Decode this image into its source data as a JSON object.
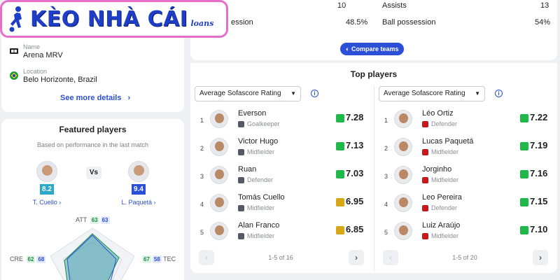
{
  "brand": {
    "title": "KÈO NHÀ CÁI",
    "subtitle": "loans"
  },
  "venue": {
    "name_label": "Name",
    "name_value": "Arena MRV",
    "location_label": "Location",
    "location_value": "Belo Horizonte, Brazil",
    "see_more": "See more details"
  },
  "featured": {
    "title": "Featured players",
    "subtitle": "Based on performance in the last match",
    "vs": "Vs",
    "left": {
      "name": "T. Cuello",
      "rating": "8.2",
      "color": "#2aa8c9"
    },
    "right": {
      "name": "L. Paquetá",
      "rating": "9.4",
      "color": "#2c4fd8"
    },
    "att_label": "ATT",
    "att_a": "63",
    "att_b": "63",
    "cre_label": "CRE",
    "cre_a": "62",
    "cre_b": "68",
    "tec_label": "TEC",
    "tec_a": "67",
    "tec_b": "58"
  },
  "stats": {
    "left_value": "10",
    "assists_label": "Assists",
    "assists_value": "13",
    "possession_left_label": "ession",
    "possession_left": "48.5%",
    "possession_label": "Ball possession",
    "possession_right": "54%",
    "compare": "Compare teams"
  },
  "top_players": {
    "title": "Top players",
    "info_icon": "info-icon",
    "left": {
      "select": "Average Sofascore Rating",
      "pager": "1-5 of 16",
      "players": [
        {
          "rank": "1",
          "name": "Everson",
          "position": "Goalkeeper",
          "rating": "7.28",
          "color": "#1fb94a"
        },
        {
          "rank": "2",
          "name": "Victor Hugo",
          "position": "Midfielder",
          "rating": "7.13",
          "color": "#1fb94a"
        },
        {
          "rank": "3",
          "name": "Ruan",
          "position": "Defender",
          "rating": "7.03",
          "color": "#1fb94a"
        },
        {
          "rank": "4",
          "name": "Tomás Cuello",
          "position": "Midfielder",
          "rating": "6.95",
          "color": "#d8a717"
        },
        {
          "rank": "5",
          "name": "Alan Franco",
          "position": "Midfielder",
          "rating": "6.85",
          "color": "#d8a717"
        }
      ]
    },
    "right": {
      "select": "Average Sofascore Rating",
      "pager": "1-5 of 20",
      "players": [
        {
          "rank": "1",
          "name": "Léo Ortiz",
          "position": "Defender",
          "rating": "7.22",
          "color": "#1fb94a"
        },
        {
          "rank": "2",
          "name": "Lucas Paquetá",
          "position": "Midfielder",
          "rating": "7.19",
          "color": "#1fb94a"
        },
        {
          "rank": "3",
          "name": "Jorginho",
          "position": "Midfielder",
          "rating": "7.16",
          "color": "#1fb94a"
        },
        {
          "rank": "4",
          "name": "Leo Pereira",
          "position": "Defender",
          "rating": "7.15",
          "color": "#1fb94a"
        },
        {
          "rank": "5",
          "name": "Luiz Araújo",
          "position": "Midfielder",
          "rating": "7.10",
          "color": "#1fb94a"
        }
      ]
    }
  }
}
